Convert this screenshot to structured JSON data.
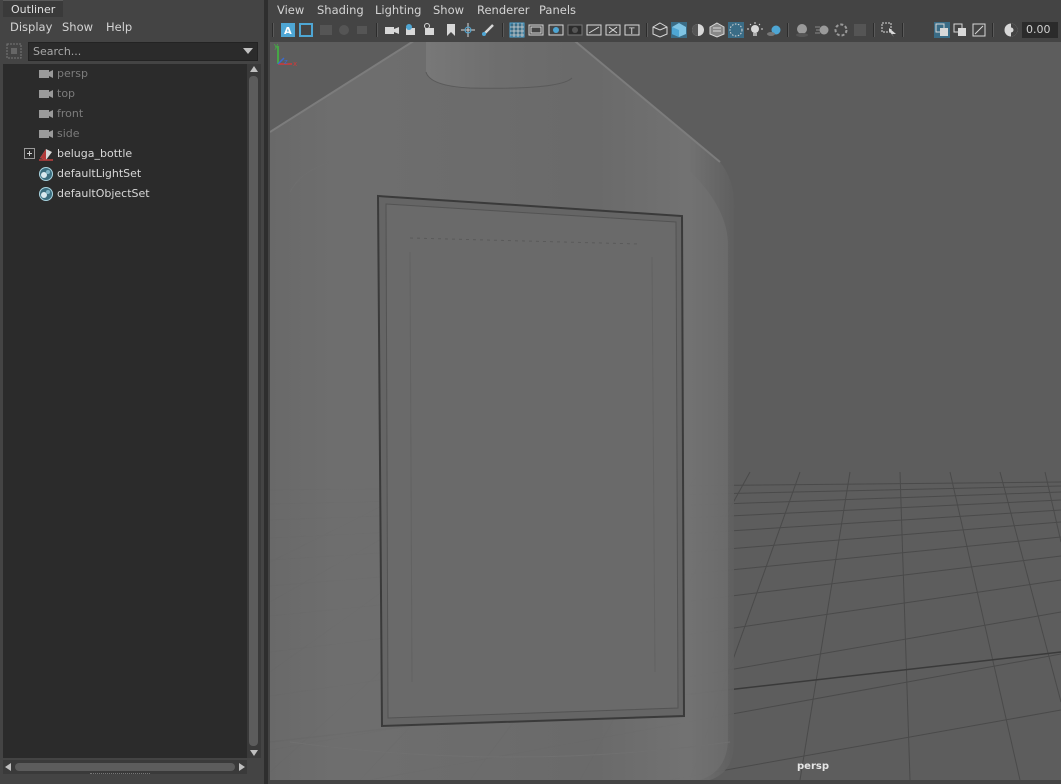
{
  "outliner": {
    "tab_title": "Outliner",
    "menu": [
      "Display",
      "Show",
      "Help"
    ],
    "search_placeholder": "Search...",
    "items": [
      {
        "label": "persp",
        "icon": "camera-icon",
        "dim": true
      },
      {
        "label": "top",
        "icon": "camera-icon",
        "dim": true
      },
      {
        "label": "front",
        "icon": "camera-icon",
        "dim": true
      },
      {
        "label": "side",
        "icon": "camera-icon",
        "dim": true
      },
      {
        "label": "beluga_bottle",
        "icon": "mesh-transform-icon",
        "expandable": true
      },
      {
        "label": "defaultLightSet",
        "icon": "set-icon"
      },
      {
        "label": "defaultObjectSet",
        "icon": "set-icon"
      }
    ]
  },
  "viewport": {
    "menu": [
      "View",
      "Shading",
      "Lighting",
      "Show",
      "Renderer",
      "Panels"
    ],
    "exposure_value": "0.00",
    "camera_label": "persp",
    "toolbar_icons": [
      "select-camera-icon",
      "camera-attributes-icon",
      "bookmarks-icon",
      "image-plane-icon",
      "2d-pan-zoom-icon",
      "grease-pencil-icon",
      "grid-icon",
      "film-gate-icon",
      "resolution-gate-icon",
      "gate-mask-icon",
      "field-chart-icon",
      "safe-action-icon",
      "safe-title-icon",
      "wireframe-icon",
      "smooth-shade-icon",
      "wireframe-on-shaded-icon",
      "textured-icon",
      "xray-icon",
      "use-all-lights-icon",
      "shadows-icon",
      "ambient-occlusion-icon",
      "motion-blur-icon",
      "anti-aliasing-icon",
      "depth-of-field-icon",
      "isolate-select-icon",
      "xray-active-icon",
      "xray-joints-icon",
      "backface-icon",
      "exposure-icon"
    ],
    "colors": {
      "viewport_bg": "#5d5d5d",
      "active_icon": "#4ea6d4"
    }
  }
}
